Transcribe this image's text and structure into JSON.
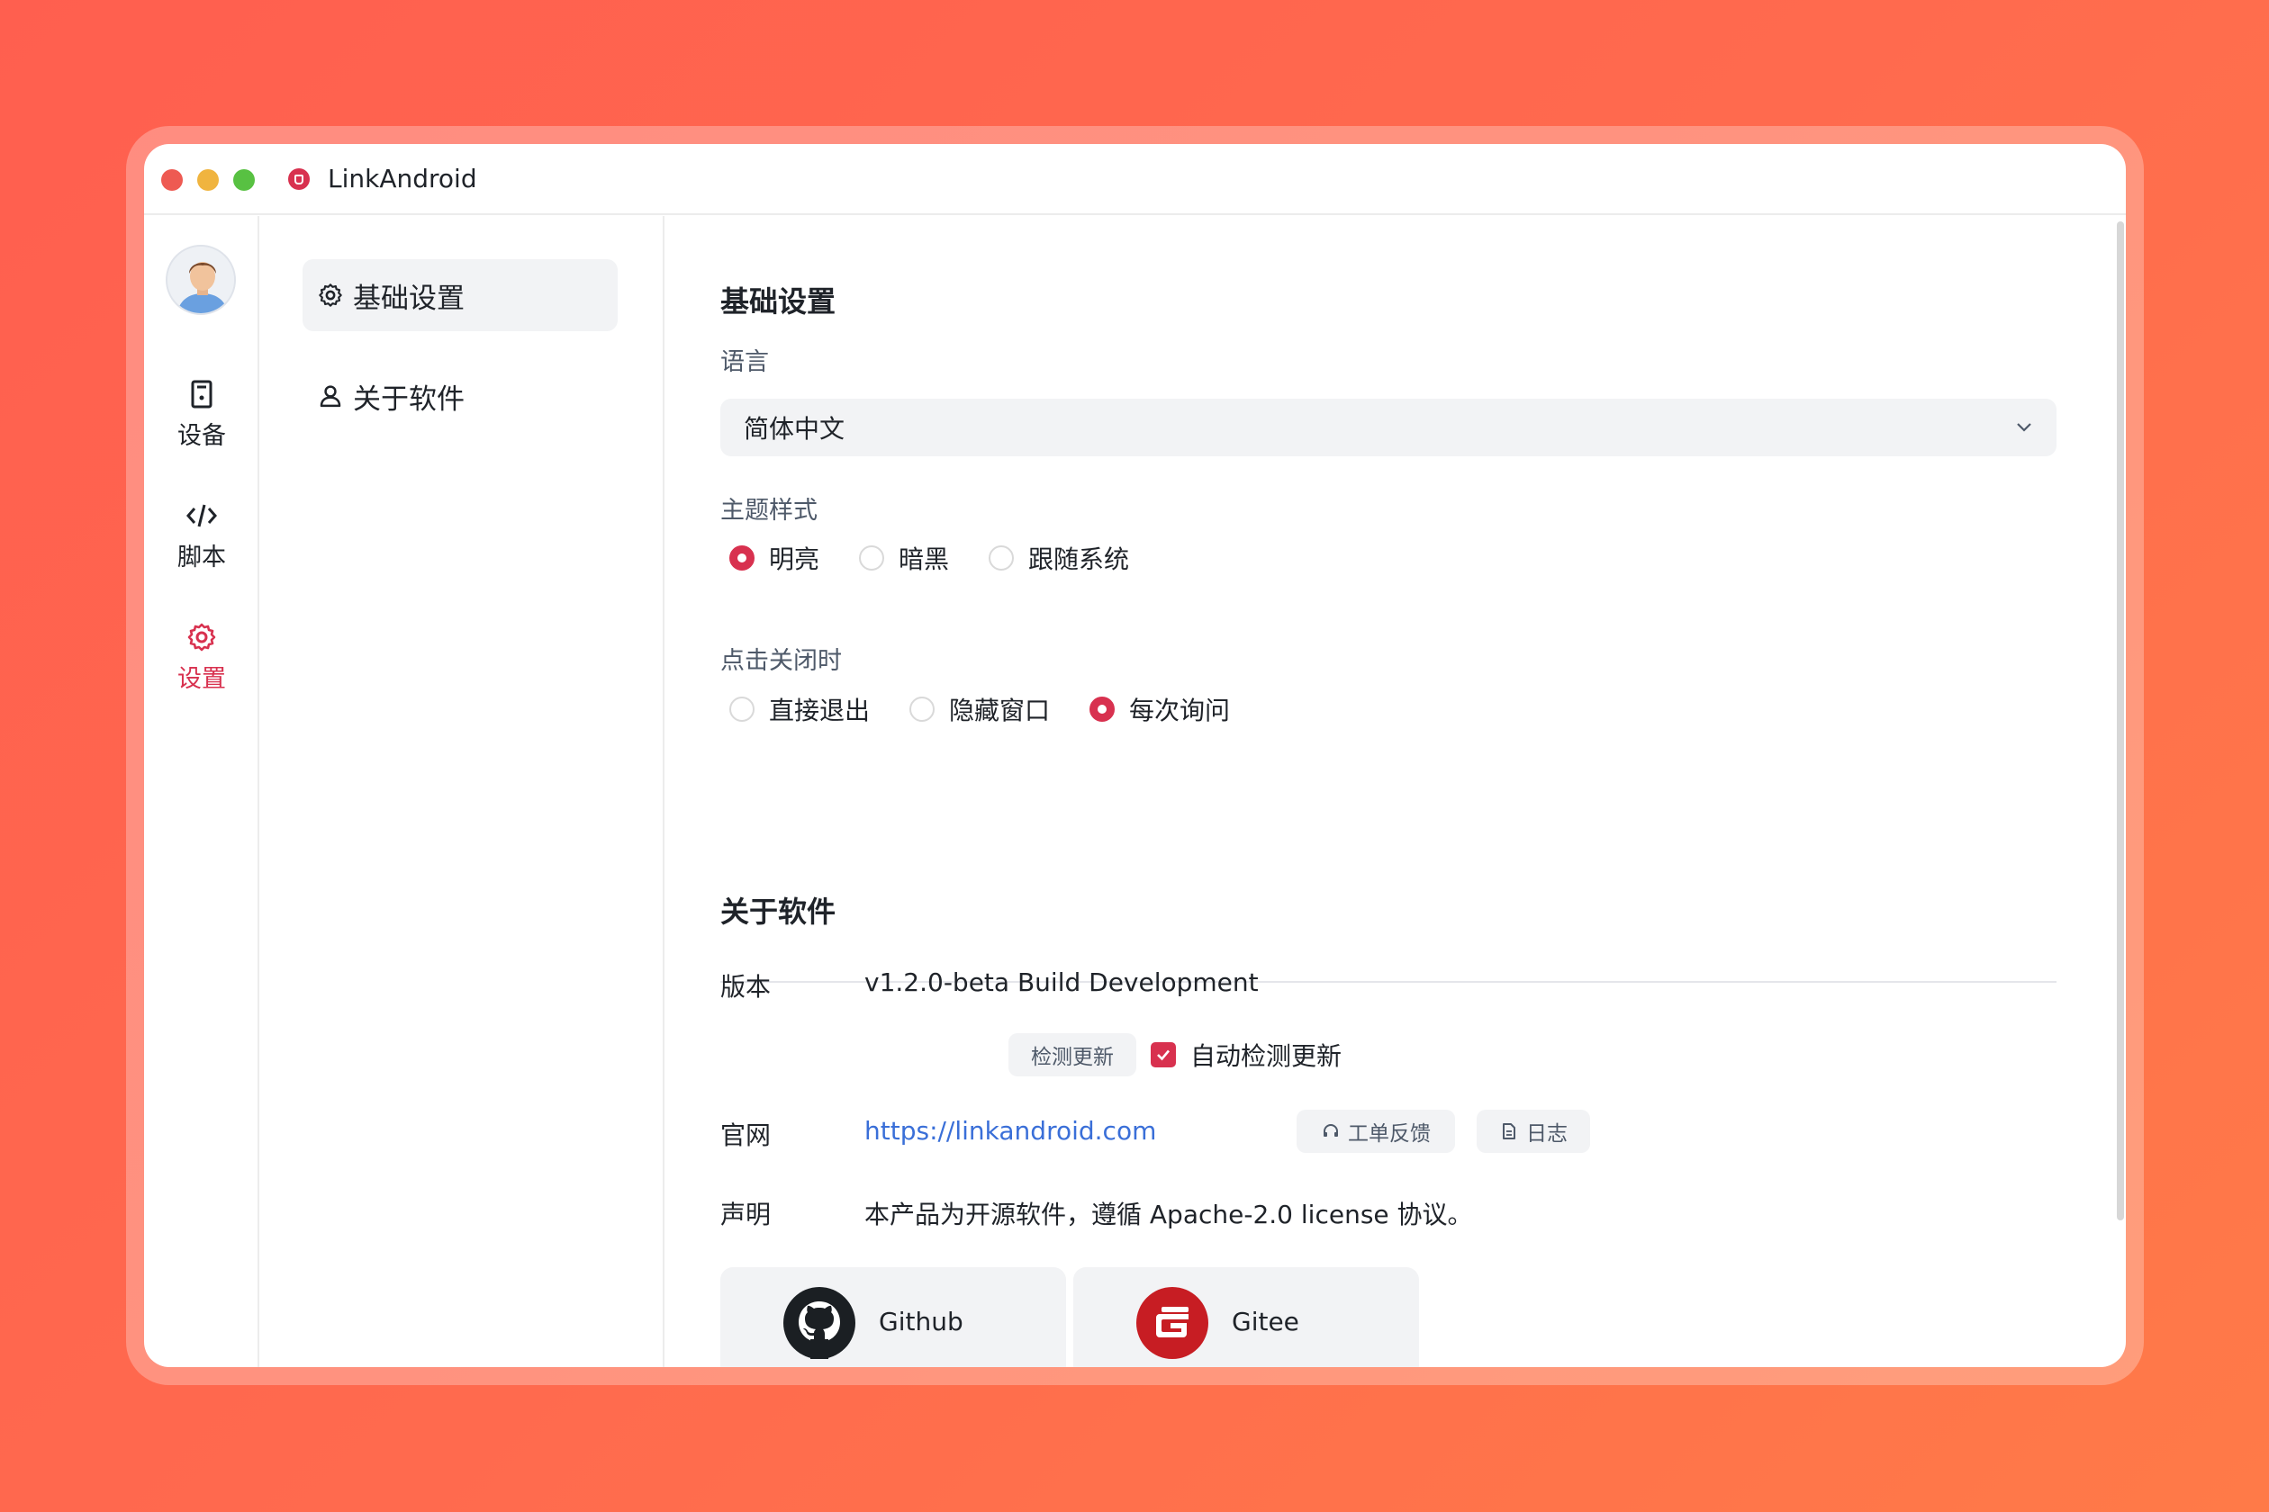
{
  "window": {
    "title": "LinkAndroid"
  },
  "rail": {
    "items": [
      {
        "label": "设备",
        "icon": "device-icon"
      },
      {
        "label": "脚本",
        "icon": "code-icon"
      },
      {
        "label": "设置",
        "icon": "gear-icon",
        "active": true
      }
    ]
  },
  "subnav": {
    "items": [
      {
        "label": "基础设置",
        "icon": "gear-icon",
        "active": true
      },
      {
        "label": "关于软件",
        "icon": "user-icon"
      }
    ]
  },
  "basic": {
    "title": "基础设置",
    "language_label": "语言",
    "language_value": "简体中文",
    "theme_label": "主题样式",
    "theme_options": [
      "明亮",
      "暗黑",
      "跟随系统"
    ],
    "theme_selected": "明亮",
    "close_label": "点击关闭时",
    "close_options": [
      "直接退出",
      "隐藏窗口",
      "每次询问"
    ],
    "close_selected": "每次询问"
  },
  "about": {
    "title": "关于软件",
    "version_label": "版本",
    "version_value": "v1.2.0-beta Build Development",
    "check_update_button": "检测更新",
    "auto_check_label": "自动检测更新",
    "auto_check_checked": true,
    "website_label": "官网",
    "website_url": "https://linkandroid.com",
    "feedback_button": "工单反馈",
    "log_button": "日志",
    "statement_label": "声明",
    "statement_text": "本产品为开源软件，遵循 Apache-2.0 license 协议。",
    "repos": [
      {
        "label": "Github",
        "icon": "github-icon"
      },
      {
        "label": "Gitee",
        "icon": "gitee-icon"
      }
    ]
  },
  "colors": {
    "accent": "#d8314f",
    "link": "#3a6fd8",
    "background_gradient": [
      "#ff5f4f",
      "#ff7a48"
    ]
  }
}
